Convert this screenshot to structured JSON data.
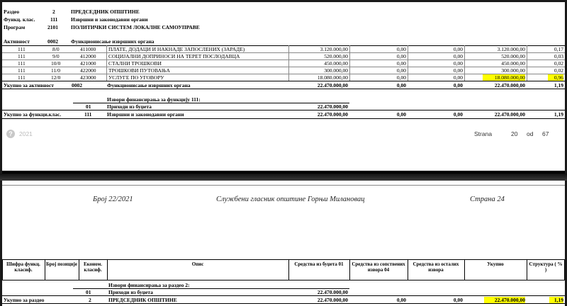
{
  "top": {
    "header": [
      {
        "label": "Раздео",
        "code": "2",
        "name": "ПРЕДСЕДНИК ОПШТИНЕ"
      },
      {
        "label": "Функц. клас.",
        "code": "111",
        "name": "Извршни и законодавни органи"
      },
      {
        "label": "Програм",
        "code": "2101",
        "name": "ПОЛИТИЧКИ СИСТЕМ ЛОКАЛНЕ САМОУПРАВЕ"
      }
    ],
    "activity": {
      "label": "Активност",
      "code": "0002",
      "name": "Функционисање извршних органа"
    },
    "rows": [
      {
        "func": "111",
        "pos": "8/0",
        "econ": "411000",
        "desc": "ПЛАТЕ, ДОДАЦИ И НАКНАДЕ ЗАПОСЛЕНИХ (ЗАРАДЕ)",
        "budget": "3.120.000,00",
        "own": "0,00",
        "other": "0,00",
        "total": "3.120.000,00",
        "struct": "0,17"
      },
      {
        "func": "111",
        "pos": "9/0",
        "econ": "412000",
        "desc": "СОЦИЈАЛНИ ДОПРИНОСИ НА ТЕРЕТ ПОСЛОДАВЦА",
        "budget": "520.000,00",
        "own": "0,00",
        "other": "0,00",
        "total": "520.000,00",
        "struct": "0,03"
      },
      {
        "func": "111",
        "pos": "10/0",
        "econ": "421000",
        "desc": "СТАЛНИ ТРОШКОВИ",
        "budget": "450.000,00",
        "own": "0,00",
        "other": "0,00",
        "total": "450.000,00",
        "struct": "0,02"
      },
      {
        "func": "111",
        "pos": "11/0",
        "econ": "422000",
        "desc": "ТРОШКОВИ ПУТОВАЊА",
        "budget": "300.000,00",
        "own": "0,00",
        "other": "0,00",
        "total": "300.000,00",
        "struct": "0,02"
      },
      {
        "func": "111",
        "pos": "12/0",
        "econ": "423000",
        "desc": "УСЛУГЕ ПО УГОВОРУ",
        "budget": "18.080.000,00",
        "own": "0,00",
        "other": "0,00",
        "total": "18.080.000,00",
        "struct": "0,96"
      }
    ],
    "activity_total": {
      "label": "Укупно за активност",
      "code": "0002",
      "name": "Функционисање извршних органа",
      "budget": "22.470.000,00",
      "own": "0,00",
      "other": "0,00",
      "total": "22.470.000,00",
      "struct": "1,19"
    },
    "sources_title": "Извори финансирања за функцију 111:",
    "source_row": {
      "code": "01",
      "name": "Приходи из буџета",
      "budget": "22.470.000,00"
    },
    "func_total": {
      "label": "Укупно за функци.клас.",
      "code": "111",
      "name": "Извршни и законодавни органи",
      "budget": "22.470.000,00",
      "own": "0,00",
      "other": "0,00",
      "total": "22.470.000,00",
      "struct": "1,19"
    },
    "footer": {
      "year": "2021",
      "strana_label": "Strana",
      "page": "20",
      "od_label": "od",
      "pages": "67"
    }
  },
  "bottom": {
    "running_header": {
      "number": "Број 22/2021",
      "journal": "Службени гласник општине Горњи Милановац",
      "page": "Страна 24"
    },
    "columns": [
      "Шифра функц. класиф.",
      "Број позиције",
      "Економ. класиф.",
      "Опис",
      "Средства из буџета 01",
      "Средства из сопствених извора 04",
      "Средства из осталих извора",
      "Укупно",
      "Структура ( % )"
    ],
    "sources_title": "Извори финансирања за раздео 2:",
    "source_row": {
      "code": "01",
      "name": "Приходи из буџета",
      "budget": "22.470.000,00"
    },
    "total_row": {
      "label": "Укупно за раздео",
      "code": "2",
      "name": "ПРЕДСЕДНИК ОПШТИНЕ",
      "budget": "22.470.000,00",
      "own": "0,00",
      "other": "0,00",
      "total": "22.470.000,00",
      "struct": "1,19"
    }
  },
  "colors": {
    "highlight": "#ffff00",
    "frame": "#1a1a1a"
  }
}
